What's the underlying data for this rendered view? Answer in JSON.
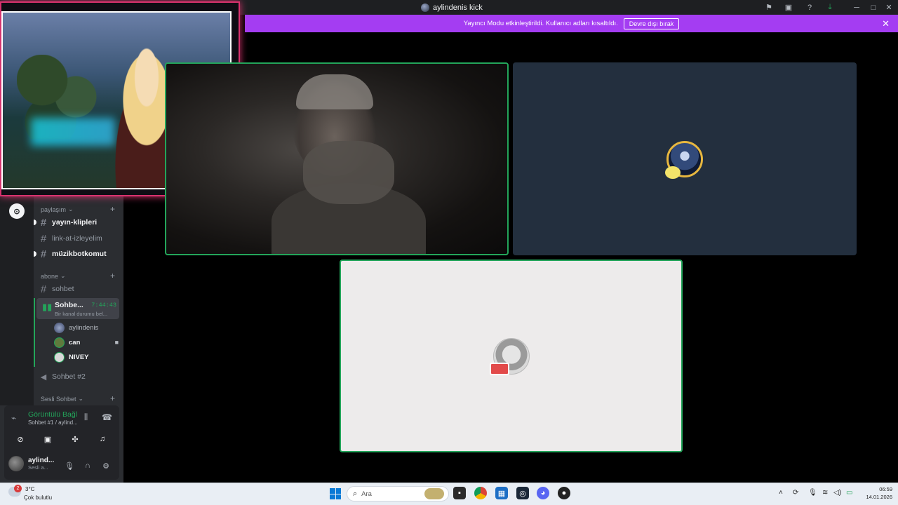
{
  "window": {
    "title": "aylindenis kick",
    "controls": {
      "minimize": "─",
      "maximize": "□",
      "close": "✕"
    }
  },
  "banner": {
    "message": "Yayıncı Modu etkinleştirildi. Kullanıcı adları kısaltıldı.",
    "button": "Devre dışı bırak",
    "close": "✕"
  },
  "sidebar": {
    "categories": [
      {
        "label": "paylaşım",
        "top": 0
      },
      {
        "label": "abone",
        "top": 0
      },
      {
        "label": "Sesli Sohbet",
        "top": 0
      }
    ],
    "channels": {
      "yayin_klipleri": "yayın-klipleri",
      "link_at": "link-at-izleyelim",
      "muzikbot": "müzikbotkomut",
      "sohbet": "sohbet",
      "sohbet2": "Sohbet #2"
    },
    "voice_channel": {
      "name": "Sohbe...",
      "timer": "7:44:43",
      "status": "Bir kanal durumu bel..."
    },
    "voice_users": [
      "aylindenis",
      "can",
      "NIVEY"
    ]
  },
  "voice_panel": {
    "status": "Görüntülü Bağl",
    "channel": "Sohbet #1 / aylind...",
    "user": {
      "name": "aylind...",
      "status": "Sesli a..."
    }
  },
  "taskbar": {
    "weather_badge": "2",
    "weather_temp": "3°C",
    "weather_desc": "Çok bulutlu",
    "search_placeholder": "Ara",
    "time": "06:59",
    "date": "14.01.2026"
  },
  "colors": {
    "accent_green": "#23a55a",
    "banner_purple": "#a43df2",
    "stream_border": "#d8326e",
    "sidebar_bg": "#2b2d31"
  },
  "icons": [
    "server-icon",
    "inbox-icon",
    "help-icon",
    "download-icon",
    "hash-icon",
    "speaker-icon",
    "camera-icon",
    "mic-icon",
    "headphones-icon",
    "settings-icon",
    "disconnect-icon",
    "windows-icon",
    "search-icon",
    "chrome-icon",
    "steam-icon",
    "discord-icon"
  ]
}
